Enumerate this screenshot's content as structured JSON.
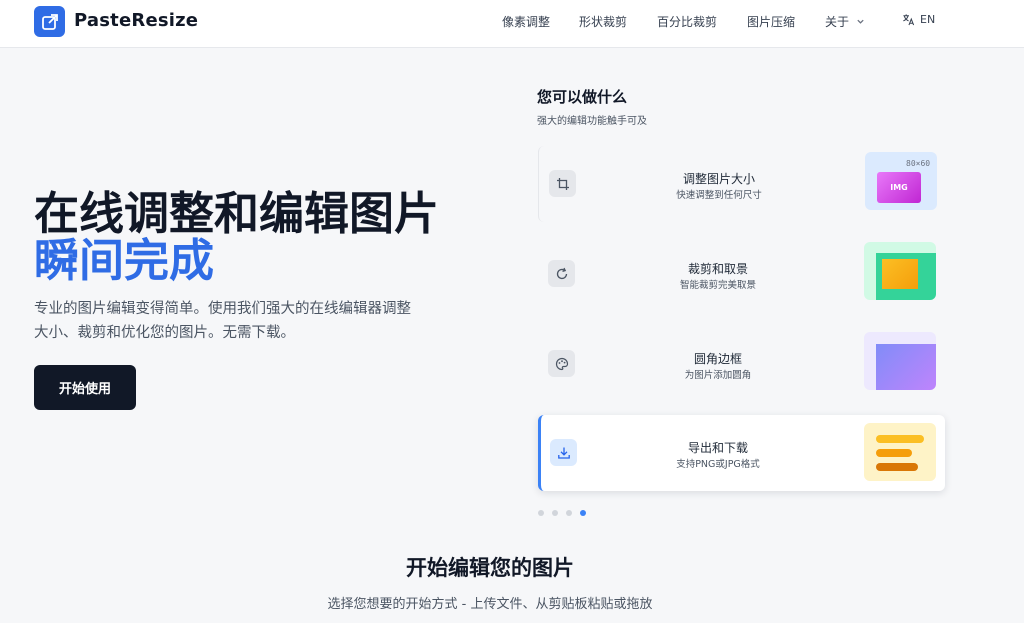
{
  "header": {
    "brand": "PasteResize",
    "nav": [
      {
        "label": "像素调整"
      },
      {
        "label": "形状裁剪"
      },
      {
        "label": "百分比裁剪"
      },
      {
        "label": "图片压缩"
      },
      {
        "label": "关于"
      }
    ],
    "lang": "EN"
  },
  "hero": {
    "title_line1": "在线调整和编辑图片",
    "title_line2": "瞬间完成",
    "description": "专业的图片编辑变得简单。使用我们强大的在线编辑器调整大小、裁剪和优化您的图片。无需下载。",
    "cta_label": "开始使用"
  },
  "features": {
    "title": "您可以做什么",
    "subtitle": "强大的编辑功能触手可及",
    "items": [
      {
        "title": "调整图片大小",
        "subtitle": "快速调整到任何尺寸",
        "thumb_label": "IMG",
        "thumb_size": "80×60"
      },
      {
        "title": "裁剪和取景",
        "subtitle": "智能裁剪完美取景"
      },
      {
        "title": "圆角边框",
        "subtitle": "为图片添加圆角"
      },
      {
        "title": "导出和下载",
        "subtitle": "支持PNG或JPG格式"
      }
    ],
    "active_index": 3,
    "dots_total": 4
  },
  "section": {
    "title": "开始编辑您的图片",
    "subtitle": "选择您想要的开始方式 - 上传文件、从剪贴板粘贴或拖放"
  },
  "colors": {
    "accent": "#2f6ce5",
    "dark": "#111827",
    "background": "#f6f7f9"
  }
}
